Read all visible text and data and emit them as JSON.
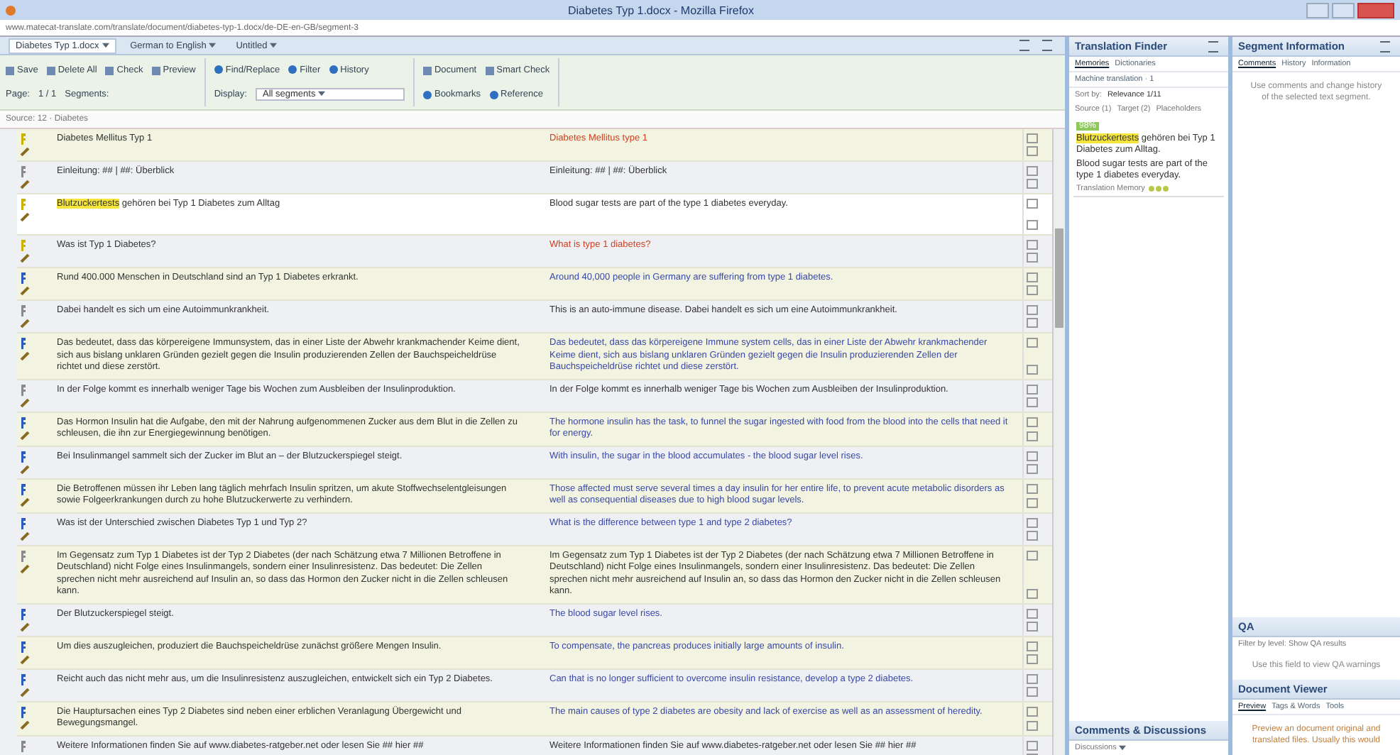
{
  "window": {
    "title": "Diabetes Typ 1.docx - Mozilla Firefox",
    "url": "www.matecat-translate.com/translate/document/diabetes-typ-1.docx/de-DE-en-GB/segment-3"
  },
  "tabs": [
    {
      "label": "Diabetes Typ 1.docx",
      "selected": true
    },
    {
      "label": "German to English",
      "selected": false
    },
    {
      "label": "Untitled",
      "selected": false
    }
  ],
  "toolbar": {
    "groups": [
      [
        "Save",
        "Delete All",
        "Check",
        "Preview"
      ],
      [
        "Find/Replace",
        "Filter",
        "History"
      ],
      [
        "Document",
        "Smart Check"
      ]
    ],
    "page_label": "Page:",
    "page_value": "1 / 1",
    "segments_label": "Segments:",
    "display_label": "Display:",
    "display_value": "All segments",
    "extra": [
      "Bookmarks",
      "Reference"
    ]
  },
  "filter": "Source: 12 · Diabetes",
  "segments": [
    {
      "color": "#c8b400",
      "source": "Diabetes Mellitus Typ 1",
      "target": "Diabetes Mellitus type 1",
      "kind": "new",
      "selected": false
    },
    {
      "color": "#8a8a8a",
      "source": "Einleitung: ## | ##: Überblick",
      "target": "Einleitung: ## | ##: Überblick",
      "kind": "copied",
      "selected": false
    },
    {
      "color": "#c8b400",
      "source": "**Blutzuckertests** gehören bei Typ 1 Diabetes zum Alltag",
      "target": "Blood sugar tests are part of the type 1 diabetes everyday.",
      "kind": "copied",
      "selected": true
    },
    {
      "color": "#c8b400",
      "source": "Was ist Typ 1 Diabetes?",
      "target": "What is type 1 diabetes?",
      "kind": "new",
      "selected": false
    },
    {
      "color": "#2a5bbf",
      "source": "Rund 400.000 Menschen in Deutschland sind an Typ 1 Diabetes erkrankt.",
      "target": "Around 40,000 people in Germany are suffering from type 1 diabetes.",
      "kind": "translated",
      "selected": false
    },
    {
      "color": "#8a8a8a",
      "source": "Dabei handelt es sich um eine Autoimmunkrankheit.",
      "target": "This is an auto-immune disease. Dabei handelt es sich um eine Autoimmunkrankheit.",
      "kind": "copied",
      "selected": false
    },
    {
      "color": "#2a5bbf",
      "source": "Das bedeutet, dass das körpereigene Immunsystem, das in einer Liste der Abwehr krankmachender Keime dient, sich aus bislang unklaren Gründen gezielt gegen die Insulin produzierenden Zellen der Bauchspeicheldrüse richtet und diese zerstört.",
      "target": "Das bedeutet, dass das körpereigene Immune system cells, das in einer Liste der Abwehr krankmachender Keime dient, sich aus bislang unklaren Gründen gezielt gegen die Insulin produzierenden Zellen der Bauchspeicheldrüse richtet und diese zerstört.",
      "kind": "translated",
      "selected": false
    },
    {
      "color": "#8a8a8a",
      "source": "In der Folge kommt es innerhalb weniger Tage bis Wochen zum Ausbleiben der Insulinproduktion.",
      "target": "In der Folge kommt es innerhalb weniger Tage bis Wochen zum Ausbleiben der Insulinproduktion.",
      "kind": "copied",
      "selected": false
    },
    {
      "color": "#2a5bbf",
      "source": "Das Hormon Insulin hat die Aufgabe, den mit der Nahrung aufgenommenen Zucker aus dem Blut in die Zellen zu schleusen, die ihn zur Energiegewinnung benötigen.",
      "target": "The hormone insulin has the task, to funnel the sugar ingested with food from the blood into the cells that need it for energy.",
      "kind": "translated",
      "selected": false
    },
    {
      "color": "#2a5bbf",
      "source": "Bei Insulinmangel sammelt sich der Zucker im Blut an – der Blutzuckerspiegel steigt.",
      "target": "With insulin, the sugar in the blood accumulates - the blood sugar level rises.",
      "kind": "translated",
      "selected": false
    },
    {
      "color": "#2a5bbf",
      "source": "Die Betroffenen müssen ihr Leben lang täglich mehrfach Insulin spritzen, um akute Stoffwechselentgleisungen sowie Folgeerkrankungen durch zu hohe Blutzuckerwerte zu verhindern.",
      "target": "Those affected must serve several times a day insulin for her entire life, to prevent acute metabolic disorders as well as consequential diseases due to high blood sugar levels.",
      "kind": "translated",
      "selected": false
    },
    {
      "color": "#2a5bbf",
      "source": "Was ist der Unterschied zwischen Diabetes Typ 1 und Typ 2?",
      "target": "What is the difference between type 1 and type 2 diabetes?",
      "kind": "translated",
      "selected": false
    },
    {
      "color": "#8a8a8a",
      "source": "Im Gegensatz zum Typ 1 Diabetes ist der Typ 2 Diabetes (der nach Schätzung etwa 7 Millionen Betroffene in Deutschland) nicht Folge eines Insulinmangels, sondern einer Insulinresistenz. Das bedeutet: Die Zellen sprechen nicht mehr ausreichend auf Insulin an, so dass das Hormon den Zucker nicht in die Zellen schleusen kann.",
      "target": "Im Gegensatz zum Typ 1 Diabetes ist der Typ 2 Diabetes (der nach Schätzung etwa 7 Millionen Betroffene in Deutschland) nicht Folge eines Insulinmangels, sondern einer Insulinresistenz. Das bedeutet: Die Zellen sprechen nicht mehr ausreichend auf Insulin an, so dass das Hormon den Zucker nicht in die Zellen schleusen kann.",
      "kind": "copied",
      "selected": false
    },
    {
      "color": "#2a5bbf",
      "source": "Der Blutzuckerspiegel steigt.",
      "target": "The blood sugar level rises.",
      "kind": "translated",
      "selected": false
    },
    {
      "color": "#2a5bbf",
      "source": "Um dies auszugleichen, produziert die Bauchspeicheldrüse zunächst größere Mengen Insulin.",
      "target": "To compensate, the pancreas produces initially large amounts of insulin.",
      "kind": "translated",
      "selected": false
    },
    {
      "color": "#2a5bbf",
      "source": "Reicht auch das nicht mehr aus, um die Insulinresistenz auszugleichen, entwickelt sich ein Typ 2 Diabetes.",
      "target": "Can that is no longer sufficient to overcome insulin resistance, develop a type 2 diabetes.",
      "kind": "translated",
      "selected": false
    },
    {
      "color": "#2a5bbf",
      "source": "Die Hauptursachen eines Typ 2 Diabetes sind neben einer erblichen Veranlagung Übergewicht und Bewegungsmangel.",
      "target": "The main causes of type 2 diabetes are obesity and lack of exercise as well as an assessment of heredity.",
      "kind": "translated",
      "selected": false
    },
    {
      "color": "#8a8a8a",
      "source": "Weitere Informationen finden Sie auf www.diabetes-ratgeber.net oder lesen Sie ## hier ##",
      "target": "Weitere Informationen finden Sie auf www.diabetes-ratgeber.net oder lesen Sie ## hier ##",
      "kind": "copied",
      "selected": false
    }
  ],
  "finder": {
    "title": "Translation Finder",
    "tabs": [
      {
        "label": "Memories",
        "selected": true
      },
      {
        "label": "Dictionaries",
        "selected": false
      }
    ],
    "machine": "Machine translation · 1",
    "sort_label": "Sort by:",
    "sort_value": "Relevance 1/11",
    "filters": [
      "Source (1)",
      "Target (2)",
      "Placeholders"
    ],
    "match": {
      "badge": "98%",
      "source": "**Blutzuckertests** gehören bei Typ 1 Diabetes zum Alltag.",
      "target": "Blood sugar tests are part of the type 1 diabetes everyday.",
      "origin": "Translation Memory",
      "stars": 3
    }
  },
  "segment_info": {
    "title": "Segment Information",
    "tabs": [
      {
        "label": "Comments",
        "selected": true
      },
      {
        "label": "History",
        "selected": false
      },
      {
        "label": "Information",
        "selected": false
      }
    ],
    "message": "Use comments and change history of the selected text segment."
  },
  "qa": {
    "title": "QA",
    "filter": "Filter by level: Show QA results",
    "message": "Use this field to view QA warnings"
  },
  "viewer": {
    "title": "Document Viewer",
    "tabs": [
      {
        "label": "Preview",
        "selected": true
      },
      {
        "label": "Tags & Words",
        "selected": false
      },
      {
        "label": "Tools",
        "selected": false
      }
    ],
    "message": "Preview an document original and translated files. Usually this would"
  },
  "comments": {
    "title": "Comments & Discussions",
    "filter": "Discussions"
  }
}
